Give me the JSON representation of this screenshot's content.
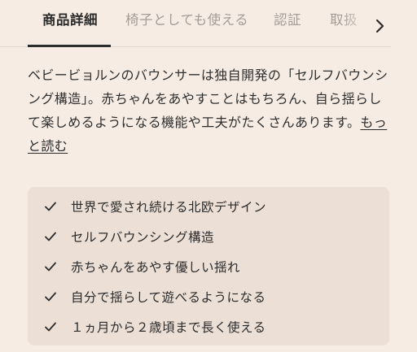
{
  "tabs": [
    {
      "label": "商品詳細",
      "active": true
    },
    {
      "label": "椅子としても使える",
      "active": false
    },
    {
      "label": "認証",
      "active": false
    },
    {
      "label": "取扱",
      "active": false
    }
  ],
  "description": {
    "line1": "ベビービョルンのバウンサーは独自開発の「セルフバウンシ",
    "line2": "ング構造」。赤ちゃんをあやすことはもちろん、自ら揺らし",
    "line3": "て楽しめるようになる機能や工夫がたくさんあります。",
    "more_link_a": "もっ",
    "more_link_b": "と読む"
  },
  "features": [
    "世界で愛され続ける北欧デザイン",
    "セルフバウンシング構造",
    "赤ちゃんをあやす優しい揺れ",
    "自分で揺らして遊べるようになる",
    "１ヵ月から２歳頃まで長く使える"
  ],
  "icons": {
    "next": "chevron-right-icon",
    "check": "check-icon"
  },
  "colors": {
    "background": "#f6ece4",
    "feature_box": "#ecdfd6",
    "inactive_tab": "#a39c97",
    "text": "#2b2b2b"
  }
}
